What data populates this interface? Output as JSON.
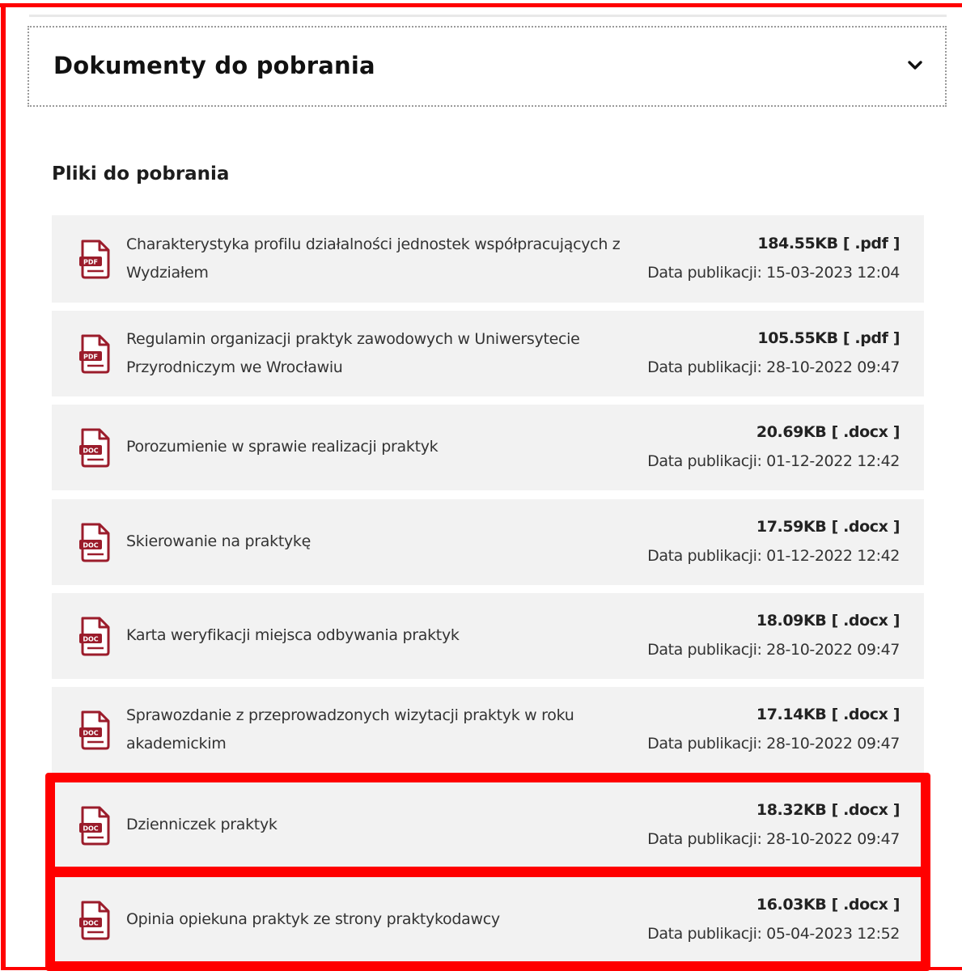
{
  "accordion": {
    "title": "Dokumenty do pobrania",
    "chevron_icon": "chevron-down-icon",
    "expanded": true
  },
  "section": {
    "title": "Pliki do pobrania"
  },
  "colors": {
    "highlight": "#ff0000",
    "icon_accent": "#9b1c2b",
    "row_background": "#f2f2f2"
  },
  "files": [
    {
      "icon": "pdf-file-icon",
      "icon_label": "PDF",
      "name_line1": "Charakterystyka profilu działalności jednostek współpracujących z",
      "name_line2": "Wydziałem",
      "size": "184.55KB [ .pdf ]",
      "date": "Data publikacji: 15-03-2023 12:04",
      "highlighted": false
    },
    {
      "icon": "pdf-file-icon",
      "icon_label": "PDF",
      "name_line1": "Regulamin organizacji praktyk zawodowych w Uniwersytecie",
      "name_line2": "Przyrodniczym we Wrocławiu",
      "size": "105.55KB [ .pdf ]",
      "date": "Data publikacji: 28-10-2022 09:47",
      "highlighted": false
    },
    {
      "icon": "doc-file-icon",
      "icon_label": "DOC",
      "name_line1": "Porozumienie w sprawie realizacji praktyk",
      "name_line2": "",
      "size": "20.69KB [ .docx ]",
      "date": "Data publikacji: 01-12-2022 12:42",
      "highlighted": false
    },
    {
      "icon": "doc-file-icon",
      "icon_label": "DOC",
      "name_line1": "Skierowanie na praktykę",
      "name_line2": "",
      "size": "17.59KB [ .docx ]",
      "date": "Data publikacji: 01-12-2022 12:42",
      "highlighted": false
    },
    {
      "icon": "doc-file-icon",
      "icon_label": "DOC",
      "name_line1": "Karta weryfikacji miejsca odbywania praktyk",
      "name_line2": "",
      "size": "18.09KB [ .docx ]",
      "date": "Data publikacji: 28-10-2022 09:47",
      "highlighted": false
    },
    {
      "icon": "doc-file-icon",
      "icon_label": "DOC",
      "name_line1": "Sprawozdanie z przeprowadzonych wizytacji praktyk w roku",
      "name_line2": "akademickim",
      "size": "17.14KB [ .docx ]",
      "date": "Data publikacji: 28-10-2022 09:47",
      "highlighted": false
    },
    {
      "icon": "doc-file-icon",
      "icon_label": "DOC",
      "name_line1": "Dzienniczek praktyk",
      "name_line2": "",
      "size": "18.32KB [ .docx ]",
      "date": "Data publikacji: 28-10-2022 09:47",
      "highlighted": true
    },
    {
      "icon": "doc-file-icon",
      "icon_label": "DOC",
      "name_line1": "Opinia opiekuna praktyk ze strony praktykodawcy",
      "name_line2": "",
      "size": "16.03KB [ .docx ]",
      "date": "Data publikacji: 05-04-2023 12:52",
      "highlighted": true
    }
  ]
}
